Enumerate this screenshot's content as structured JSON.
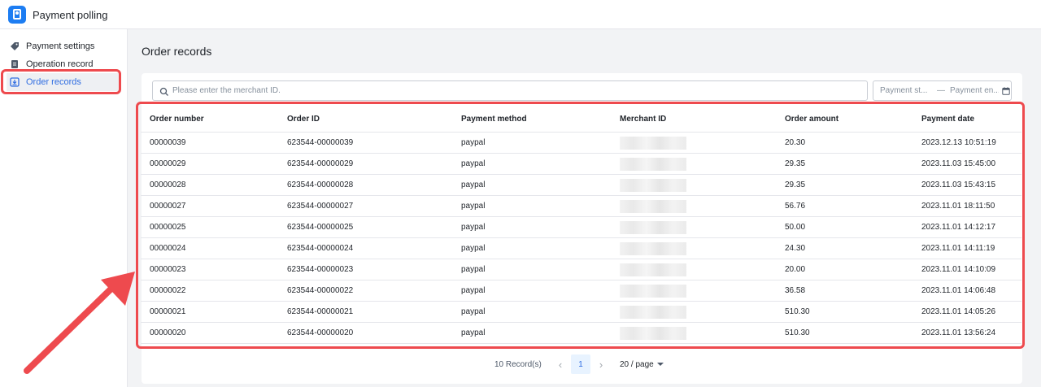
{
  "app": {
    "title": "Payment polling"
  },
  "sidebar": {
    "items": [
      {
        "label": "Payment settings",
        "icon": "tag-icon",
        "active": false
      },
      {
        "label": "Operation record",
        "icon": "document-icon",
        "active": false
      },
      {
        "label": "Order records",
        "icon": "download-icon",
        "active": true
      }
    ]
  },
  "main": {
    "title": "Order records",
    "search": {
      "placeholder": "Please enter the merchant ID.",
      "value": ""
    },
    "daterange": {
      "start_placeholder": "Payment st...",
      "separator": "—",
      "end_placeholder": "Payment en..."
    }
  },
  "table": {
    "columns": [
      "Order number",
      "Order ID",
      "Payment method",
      "Merchant ID",
      "Order amount",
      "Payment date"
    ],
    "rows": [
      {
        "order_number": "00000039",
        "order_id": "623544-00000039",
        "method": "paypal",
        "amount": "20.30",
        "date": "2023.12.13 10:51:19"
      },
      {
        "order_number": "00000029",
        "order_id": "623544-00000029",
        "method": "paypal",
        "amount": "29.35",
        "date": "2023.11.03 15:45:00"
      },
      {
        "order_number": "00000028",
        "order_id": "623544-00000028",
        "method": "paypal",
        "amount": "29.35",
        "date": "2023.11.03 15:43:15"
      },
      {
        "order_number": "00000027",
        "order_id": "623544-00000027",
        "method": "paypal",
        "amount": "56.76",
        "date": "2023.11.01 18:11:50"
      },
      {
        "order_number": "00000025",
        "order_id": "623544-00000025",
        "method": "paypal",
        "amount": "50.00",
        "date": "2023.11.01 14:12:17"
      },
      {
        "order_number": "00000024",
        "order_id": "623544-00000024",
        "method": "paypal",
        "amount": "24.30",
        "date": "2023.11.01 14:11:19"
      },
      {
        "order_number": "00000023",
        "order_id": "623544-00000023",
        "method": "paypal",
        "amount": "20.00",
        "date": "2023.11.01 14:10:09"
      },
      {
        "order_number": "00000022",
        "order_id": "623544-00000022",
        "method": "paypal",
        "amount": "36.58",
        "date": "2023.11.01 14:06:48"
      },
      {
        "order_number": "00000021",
        "order_id": "623544-00000021",
        "method": "paypal",
        "amount": "510.30",
        "date": "2023.11.01 14:05:26"
      },
      {
        "order_number": "00000020",
        "order_id": "623544-00000020",
        "method": "paypal",
        "amount": "510.30",
        "date": "2023.11.01 13:56:24"
      }
    ]
  },
  "pagination": {
    "total": "10 Record(s)",
    "current_page": "1",
    "page_size": "20 / page"
  },
  "colors": {
    "accent": "#2f6de1",
    "highlight": "#ee4a4e",
    "logo": "#1d7df2"
  }
}
